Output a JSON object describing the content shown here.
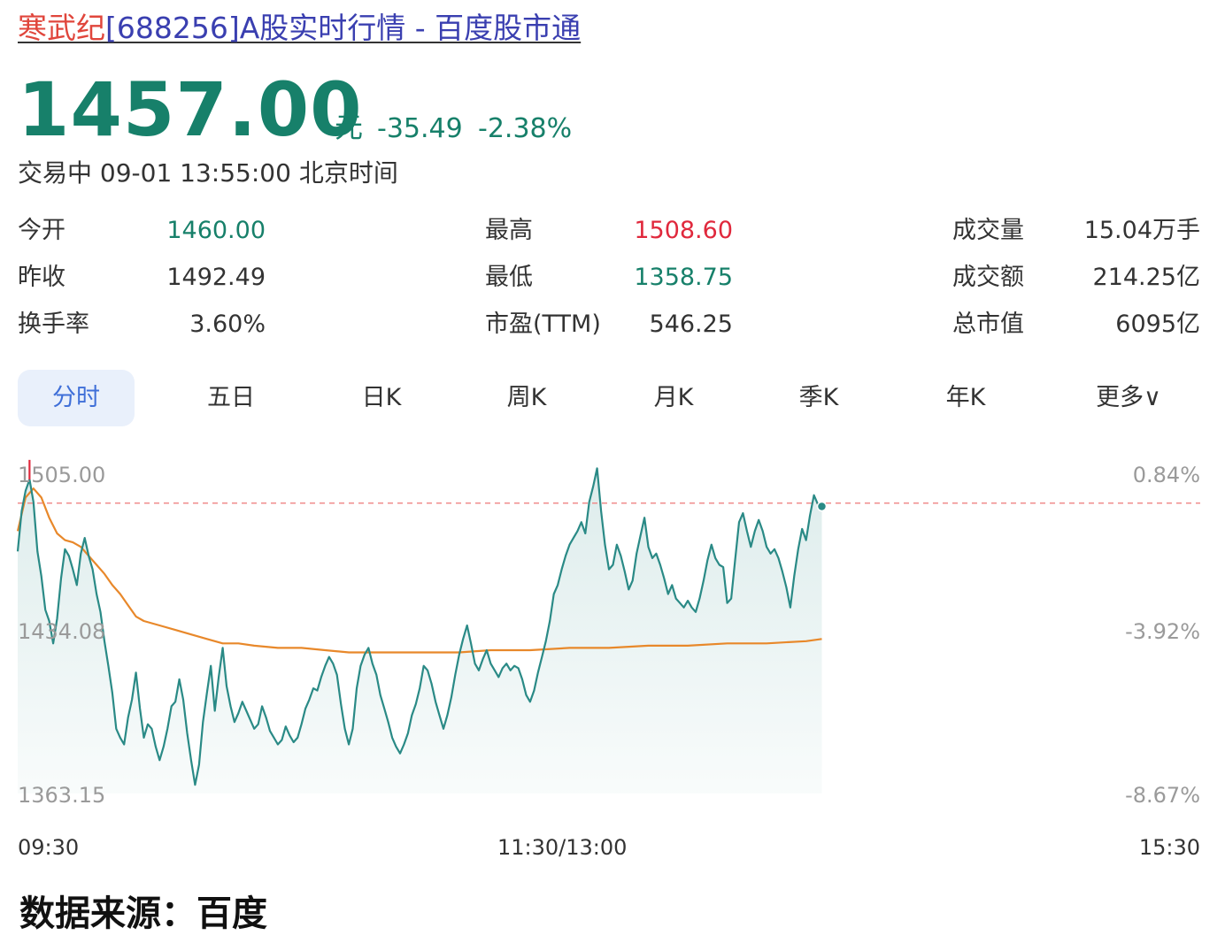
{
  "header": {
    "title_name": "寒武纪",
    "title_rest": "[688256]A股实时行情 - 百度股市通"
  },
  "quote": {
    "price": "1457.00",
    "unit": "元",
    "change": "-35.49",
    "change_pct": "-2.38%",
    "status": "交易中 09-01 13:55:00 北京时间",
    "down_color": "#17806a",
    "up_color": "#e0283c"
  },
  "stats": {
    "open_label": "今开",
    "open_value": "1460.00",
    "high_label": "最高",
    "high_value": "1508.60",
    "volume_label": "成交量",
    "volume_value": "15.04万手",
    "prev_close_label": "昨收",
    "prev_close_value": "1492.49",
    "low_label": "最低",
    "low_value": "1358.75",
    "amount_label": "成交额",
    "amount_value": "214.25亿",
    "turnover_label": "换手率",
    "turnover_value": "3.60%",
    "pe_label": "市盈(TTM)",
    "pe_value": "546.25",
    "mcap_label": "总市值",
    "mcap_value": "6095亿"
  },
  "tabs": [
    {
      "label": "分时",
      "active": true
    },
    {
      "label": "五日",
      "active": false
    },
    {
      "label": "日K",
      "active": false
    },
    {
      "label": "周K",
      "active": false
    },
    {
      "label": "月K",
      "active": false
    },
    {
      "label": "季K",
      "active": false
    },
    {
      "label": "年K",
      "active": false
    },
    {
      "label": "更多∨",
      "active": false
    }
  ],
  "source": "数据来源：百度",
  "chart_data": {
    "type": "line",
    "ylim": [
      1363.15,
      1505.0
    ],
    "y_ticks_left": [
      "1505.00",
      "1434.08",
      "1363.15"
    ],
    "y_ticks_right": [
      "0.84%",
      "-3.92%",
      "-8.67%"
    ],
    "x_ticks": [
      "09:30",
      "11:30/13:00",
      "15:30"
    ],
    "prev_close": 1492.49,
    "line_color": "#2a8a86",
    "avg_color": "#e8882a",
    "ref_color": "#f08c8c",
    "series": [
      {
        "points": [
          [
            0,
            1471
          ],
          [
            1,
            1489
          ],
          [
            2,
            1498
          ],
          [
            3,
            1503
          ],
          [
            4,
            1493
          ],
          [
            5,
            1471
          ],
          [
            6,
            1460
          ],
          [
            7,
            1445
          ],
          [
            8,
            1440
          ],
          [
            9,
            1430
          ],
          [
            10,
            1441
          ],
          [
            11,
            1459
          ],
          [
            12,
            1472
          ],
          [
            13,
            1469
          ],
          [
            14,
            1463
          ],
          [
            15,
            1456
          ],
          [
            16,
            1470
          ],
          [
            17,
            1477
          ],
          [
            18,
            1469
          ],
          [
            19,
            1463
          ],
          [
            20,
            1452
          ],
          [
            21,
            1444
          ],
          [
            22,
            1431
          ],
          [
            23,
            1420
          ],
          [
            24,
            1408
          ],
          [
            25,
            1392
          ],
          [
            26,
            1388
          ],
          [
            27,
            1385
          ],
          [
            28,
            1397
          ],
          [
            29,
            1405
          ],
          [
            30,
            1417
          ],
          [
            31,
            1401
          ],
          [
            32,
            1388
          ],
          [
            33,
            1394
          ],
          [
            34,
            1392
          ],
          [
            35,
            1384
          ],
          [
            36,
            1378
          ],
          [
            37,
            1384
          ],
          [
            38,
            1392
          ],
          [
            39,
            1402
          ],
          [
            40,
            1404
          ],
          [
            41,
            1414
          ],
          [
            42,
            1405
          ],
          [
            43,
            1390
          ],
          [
            44,
            1378
          ],
          [
            45,
            1367
          ],
          [
            46,
            1376
          ],
          [
            47,
            1395
          ],
          [
            48,
            1408
          ],
          [
            49,
            1420
          ],
          [
            50,
            1400
          ],
          [
            51,
            1415
          ],
          [
            52,
            1428
          ],
          [
            53,
            1411
          ],
          [
            54,
            1402
          ],
          [
            55,
            1395
          ],
          [
            56,
            1399
          ],
          [
            57,
            1404
          ],
          [
            58,
            1400
          ],
          [
            59,
            1396
          ],
          [
            60,
            1392
          ],
          [
            61,
            1394
          ],
          [
            62,
            1402
          ],
          [
            63,
            1397
          ],
          [
            64,
            1391
          ],
          [
            65,
            1388
          ],
          [
            66,
            1385
          ],
          [
            67,
            1387
          ],
          [
            68,
            1393
          ],
          [
            69,
            1389
          ],
          [
            70,
            1386
          ],
          [
            71,
            1388
          ],
          [
            72,
            1394
          ],
          [
            73,
            1401
          ],
          [
            74,
            1405
          ],
          [
            75,
            1410
          ],
          [
            76,
            1409
          ],
          [
            77,
            1415
          ],
          [
            78,
            1420
          ],
          [
            79,
            1424
          ],
          [
            80,
            1421
          ],
          [
            81,
            1416
          ],
          [
            82,
            1403
          ],
          [
            83,
            1392
          ],
          [
            84,
            1385
          ],
          [
            85,
            1392
          ],
          [
            86,
            1410
          ],
          [
            87,
            1420
          ],
          [
            88,
            1425
          ],
          [
            89,
            1428
          ],
          [
            90,
            1421
          ],
          [
            91,
            1416
          ],
          [
            92,
            1407
          ],
          [
            93,
            1401
          ],
          [
            94,
            1395
          ],
          [
            95,
            1388
          ],
          [
            96,
            1384
          ],
          [
            97,
            1381
          ],
          [
            98,
            1385
          ],
          [
            99,
            1390
          ],
          [
            100,
            1398
          ],
          [
            101,
            1403
          ],
          [
            102,
            1410
          ],
          [
            103,
            1420
          ],
          [
            104,
            1418
          ],
          [
            105,
            1412
          ],
          [
            106,
            1404
          ],
          [
            107,
            1398
          ],
          [
            108,
            1392
          ],
          [
            109,
            1398
          ],
          [
            110,
            1406
          ],
          [
            111,
            1416
          ],
          [
            112,
            1425
          ],
          [
            113,
            1432
          ],
          [
            114,
            1438
          ],
          [
            115,
            1430
          ],
          [
            116,
            1421
          ],
          [
            117,
            1418
          ],
          [
            118,
            1423
          ],
          [
            119,
            1427
          ],
          [
            120,
            1421
          ],
          [
            121,
            1418
          ],
          [
            122,
            1415
          ],
          [
            123,
            1419
          ],
          [
            124,
            1421
          ],
          [
            125,
            1418
          ],
          [
            126,
            1420
          ],
          [
            127,
            1419
          ],
          [
            128,
            1414
          ],
          [
            129,
            1407
          ],
          [
            130,
            1404
          ],
          [
            131,
            1409
          ],
          [
            132,
            1417
          ],
          [
            133,
            1424
          ],
          [
            134,
            1431
          ],
          [
            135,
            1440
          ],
          [
            136,
            1452
          ],
          [
            137,
            1456
          ],
          [
            138,
            1463
          ],
          [
            139,
            1469
          ],
          [
            140,
            1474
          ],
          [
            141,
            1477
          ],
          [
            142,
            1480
          ],
          [
            143,
            1484
          ],
          [
            144,
            1479
          ],
          [
            145,
            1493
          ],
          [
            146,
            1500
          ],
          [
            147,
            1508
          ],
          [
            148,
            1489
          ],
          [
            149,
            1474
          ],
          [
            150,
            1463
          ],
          [
            151,
            1465
          ],
          [
            152,
            1474
          ],
          [
            153,
            1469
          ],
          [
            154,
            1462
          ],
          [
            155,
            1454
          ],
          [
            156,
            1458
          ],
          [
            157,
            1470
          ],
          [
            158,
            1478
          ],
          [
            159,
            1486
          ],
          [
            160,
            1473
          ],
          [
            161,
            1468
          ],
          [
            162,
            1470
          ],
          [
            163,
            1465
          ],
          [
            164,
            1459
          ],
          [
            165,
            1452
          ],
          [
            166,
            1456
          ],
          [
            167,
            1450
          ],
          [
            168,
            1448
          ],
          [
            169,
            1446
          ],
          [
            170,
            1449
          ],
          [
            171,
            1446
          ],
          [
            172,
            1444
          ],
          [
            173,
            1450
          ],
          [
            174,
            1458
          ],
          [
            175,
            1467
          ],
          [
            176,
            1474
          ],
          [
            177,
            1468
          ],
          [
            178,
            1465
          ],
          [
            179,
            1464
          ],
          [
            180,
            1448
          ],
          [
            181,
            1450
          ],
          [
            182,
            1467
          ],
          [
            183,
            1484
          ],
          [
            184,
            1488
          ],
          [
            185,
            1480
          ],
          [
            186,
            1473
          ],
          [
            187,
            1480
          ],
          [
            188,
            1485
          ],
          [
            189,
            1480
          ],
          [
            190,
            1473
          ],
          [
            191,
            1470
          ],
          [
            192,
            1472
          ],
          [
            193,
            1468
          ],
          [
            194,
            1462
          ],
          [
            195,
            1455
          ],
          [
            196,
            1446
          ],
          [
            197,
            1460
          ],
          [
            198,
            1472
          ],
          [
            199,
            1481
          ],
          [
            200,
            1476
          ],
          [
            201,
            1487
          ],
          [
            202,
            1496
          ],
          [
            203,
            1492
          ],
          [
            204,
            1491
          ]
        ]
      },
      {
        "points": [
          [
            0,
            1480
          ],
          [
            2,
            1495
          ],
          [
            4,
            1499
          ],
          [
            6,
            1495
          ],
          [
            8,
            1486
          ],
          [
            10,
            1479
          ],
          [
            12,
            1476
          ],
          [
            14,
            1475
          ],
          [
            16,
            1473
          ],
          [
            18,
            1469
          ],
          [
            20,
            1465
          ],
          [
            22,
            1461
          ],
          [
            24,
            1456
          ],
          [
            26,
            1452
          ],
          [
            28,
            1447
          ],
          [
            30,
            1442
          ],
          [
            32,
            1440
          ],
          [
            34,
            1439
          ],
          [
            36,
            1438
          ],
          [
            40,
            1436
          ],
          [
            44,
            1434
          ],
          [
            48,
            1432
          ],
          [
            52,
            1430
          ],
          [
            56,
            1430
          ],
          [
            60,
            1429
          ],
          [
            66,
            1428
          ],
          [
            72,
            1428
          ],
          [
            78,
            1427
          ],
          [
            84,
            1426
          ],
          [
            90,
            1426
          ],
          [
            96,
            1426
          ],
          [
            104,
            1426
          ],
          [
            112,
            1426
          ],
          [
            120,
            1427
          ],
          [
            130,
            1427
          ],
          [
            140,
            1428
          ],
          [
            150,
            1428
          ],
          [
            160,
            1429
          ],
          [
            170,
            1429
          ],
          [
            180,
            1430
          ],
          [
            190,
            1430
          ],
          [
            200,
            1431
          ],
          [
            204,
            1432
          ]
        ]
      }
    ]
  }
}
